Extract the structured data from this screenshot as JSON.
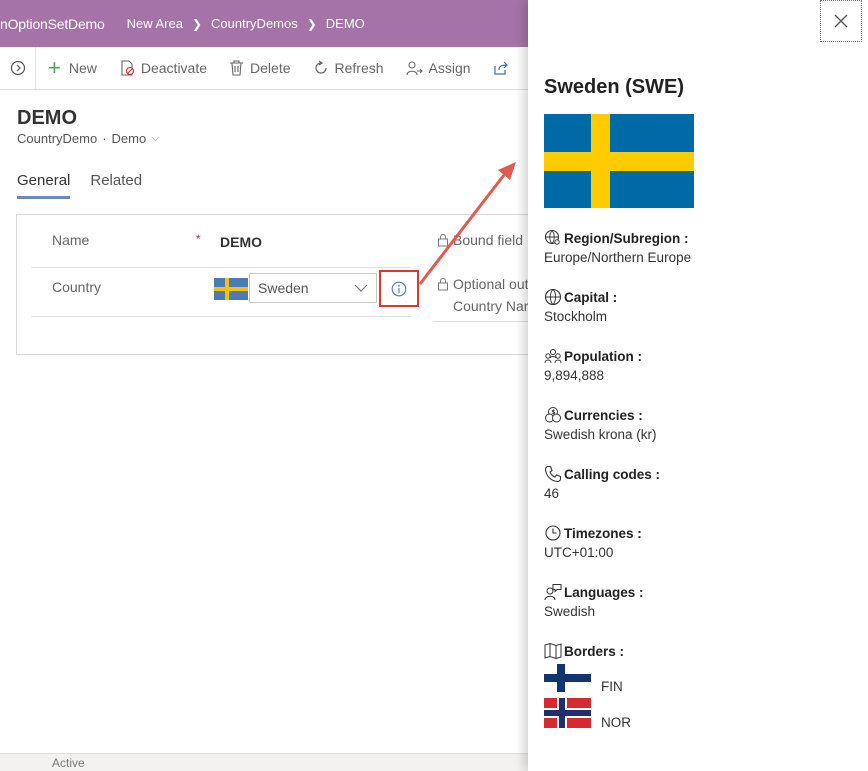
{
  "topbar": {
    "app_name": "nOptionSetDemo",
    "breadcrumbs": [
      "New Area",
      "CountryDemos",
      "DEMO"
    ]
  },
  "commands": {
    "new": "New",
    "deactivate": "Deactivate",
    "delete": "Delete",
    "refresh": "Refresh",
    "assign": "Assign"
  },
  "record": {
    "title": "DEMO",
    "entity": "CountryDemo",
    "form": "Demo"
  },
  "tabs": [
    "General",
    "Related"
  ],
  "fields": {
    "name_label": "Name",
    "required_mark": "*",
    "name_value": "DEMO",
    "country_label": "Country",
    "country_value": "Sweden",
    "bound_field": "Bound field",
    "optional_output": "Optional out",
    "country_name": "Country Nar"
  },
  "status": {
    "state": "Active"
  },
  "panel": {
    "title": "Sweden (SWE)",
    "region_label": "Region/Subregion :",
    "region_value": "Europe/Northern Europe",
    "capital_label": "Capital :",
    "capital_value": "Stockholm",
    "population_label": "Population :",
    "population_value": "9,894,888",
    "currencies_label": "Currencies :",
    "currencies_value": "Swedish krona (kr)",
    "calling_label": "Calling codes :",
    "calling_value": "46",
    "timezones_label": "Timezones :",
    "timezones_value": "UTC+01:00",
    "languages_label": "Languages :",
    "languages_value": "Swedish",
    "borders_label": "Borders :",
    "borders": [
      "FIN",
      "NOR"
    ]
  },
  "colors": {
    "topbar": "#a673a8",
    "highlight": "#d9383a",
    "tab_underline": "#6e87c1"
  }
}
